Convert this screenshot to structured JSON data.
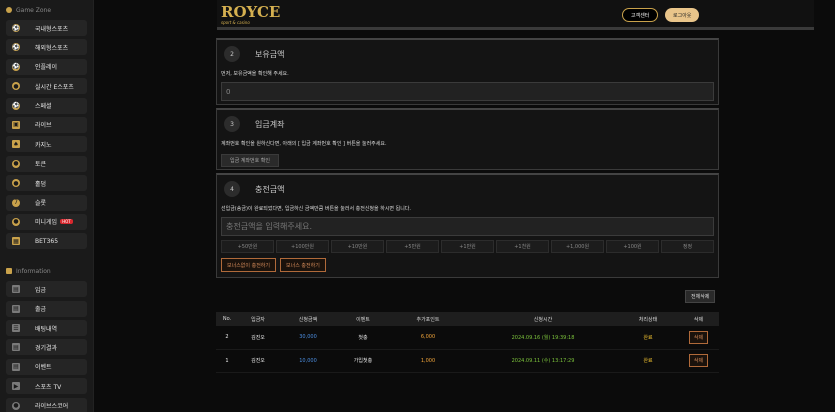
{
  "sidebar": {
    "section1": "Game Zone",
    "items": [
      {
        "label": "국내형스포츠",
        "icon": "ball-icon"
      },
      {
        "label": "해외형스포츠",
        "icon": "ball-icon"
      },
      {
        "label": "인플레이",
        "icon": "ball-icon"
      },
      {
        "label": "실시간 E스포츠",
        "icon": "gamepad-icon"
      },
      {
        "label": "스페셜",
        "icon": "ball-icon"
      },
      {
        "label": "라이브",
        "icon": "tv-icon"
      },
      {
        "label": "카지노",
        "icon": "cards-icon"
      },
      {
        "label": "토큰",
        "icon": "token-icon"
      },
      {
        "label": "홀덤",
        "icon": "chip-icon"
      },
      {
        "label": "슬롯",
        "icon": "slot-icon"
      },
      {
        "label": "미니게임",
        "icon": "minigame-icon",
        "badge": "HOT"
      },
      {
        "label": "BET365",
        "icon": "bet365-icon"
      }
    ],
    "section2": "Information",
    "info_items": [
      {
        "label": "입금",
        "icon": "deposit-icon"
      },
      {
        "label": "출금",
        "icon": "withdraw-icon"
      },
      {
        "label": "배팅내역",
        "icon": "list-icon"
      },
      {
        "label": "경기결과",
        "icon": "result-icon"
      },
      {
        "label": "이벤트",
        "icon": "event-icon"
      },
      {
        "label": "스포츠 TV",
        "icon": "sports-tv-icon"
      },
      {
        "label": "라이브스코어",
        "icon": "score-icon"
      }
    ]
  },
  "header": {
    "logo": "ROYCE",
    "logo_sub": "sport & casino",
    "support_label": "고객센터",
    "logout_label": "로그아웃"
  },
  "balance": {
    "step": "2",
    "title": "보유금액",
    "desc": "먼저, 보유금액을 확인해 주세요.",
    "value": "0"
  },
  "account": {
    "step": "3",
    "title": "입금계좌",
    "desc": "계좌번호 확인을 원하신다면, 아래의 [ 입금 계좌번호 확인 ] 버튼을 눌러주세요.",
    "button": "입금 계좌번호 확인"
  },
  "charge": {
    "step": "4",
    "title": "충전금액",
    "desc": "선입금(송금)이 완료되었다면, 입금하신 금액만큼 버튼을 눌러서 충전신청을 하시면 됩니다.",
    "placeholder": "충전금액을 입력해주세요.",
    "amounts": [
      "+50만원",
      "+100만원",
      "+10만원",
      "+5만원",
      "+1만원",
      "+1천원",
      "+1,000원",
      "+100원",
      "정정"
    ],
    "no_bonus_button": "보너스없이 충전하기",
    "bonus_button": "보너스 충전하기"
  },
  "table": {
    "delete_all": "전체삭제",
    "headers": [
      "No.",
      "입금자",
      "신청금액",
      "이벤트",
      "추가포인트",
      "신청시간",
      "처리상태",
      "삭제"
    ],
    "rows": [
      {
        "no": "2",
        "name": "김진오",
        "amount": "30,000",
        "event": "첫충",
        "points": "6,000",
        "time": "2024.09.16 (월) 19:39:18",
        "status": "완료",
        "delete": "삭제"
      },
      {
        "no": "1",
        "name": "김진오",
        "amount": "10,000",
        "event": "가입첫충",
        "points": "1,000",
        "time": "2024.09.11 (수) 13:17:29",
        "status": "완료",
        "delete": "삭제"
      }
    ]
  }
}
